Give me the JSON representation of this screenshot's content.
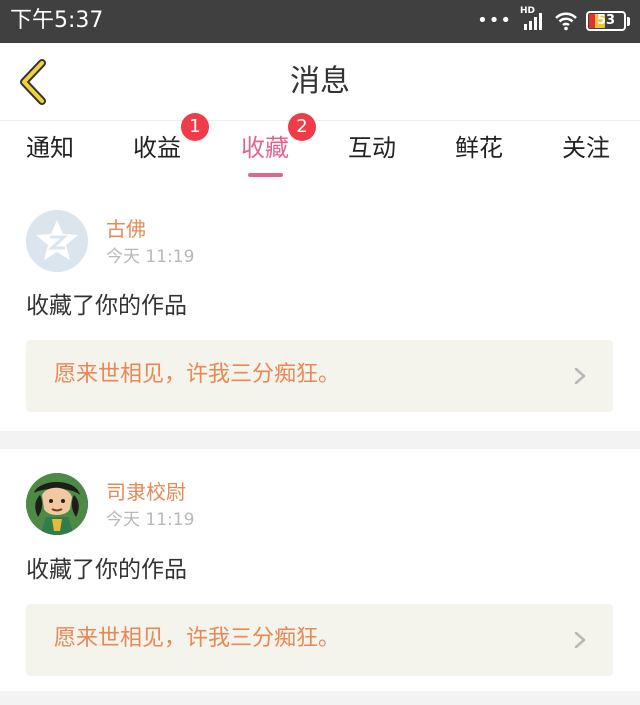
{
  "status_bar": {
    "time": "下午5:37",
    "network": "HD",
    "battery": "53",
    "icons": [
      "dots-icon",
      "signal-icon",
      "wifi-icon",
      "battery-icon"
    ]
  },
  "header": {
    "title": "消息",
    "back_icon": "chevron-left-icon"
  },
  "tabs": [
    {
      "label": "通知",
      "badge": ""
    },
    {
      "label": "收益",
      "badge": "1"
    },
    {
      "label": "收藏",
      "badge": "2",
      "active": true
    },
    {
      "label": "互动",
      "badge": ""
    },
    {
      "label": "鲜花",
      "badge": ""
    },
    {
      "label": "关注",
      "badge": ""
    }
  ],
  "messages": [
    {
      "user": "古佛",
      "time": "今天 11:19",
      "action": "收藏了你的作品",
      "quote": "愿来世相见，许我三分痴狂。",
      "avatar": "default-avatar-icon"
    },
    {
      "user": "司隶校尉",
      "time": "今天 11:19",
      "action": "收藏了你的作品",
      "quote": "愿来世相见，许我三分痴狂。",
      "avatar": "character-avatar"
    }
  ],
  "colors": {
    "accent": "#e1668f",
    "badge": "#f03c48",
    "username": "#e58a56",
    "quote_bg": "#f4f3ec",
    "status_bar": "#404040"
  }
}
